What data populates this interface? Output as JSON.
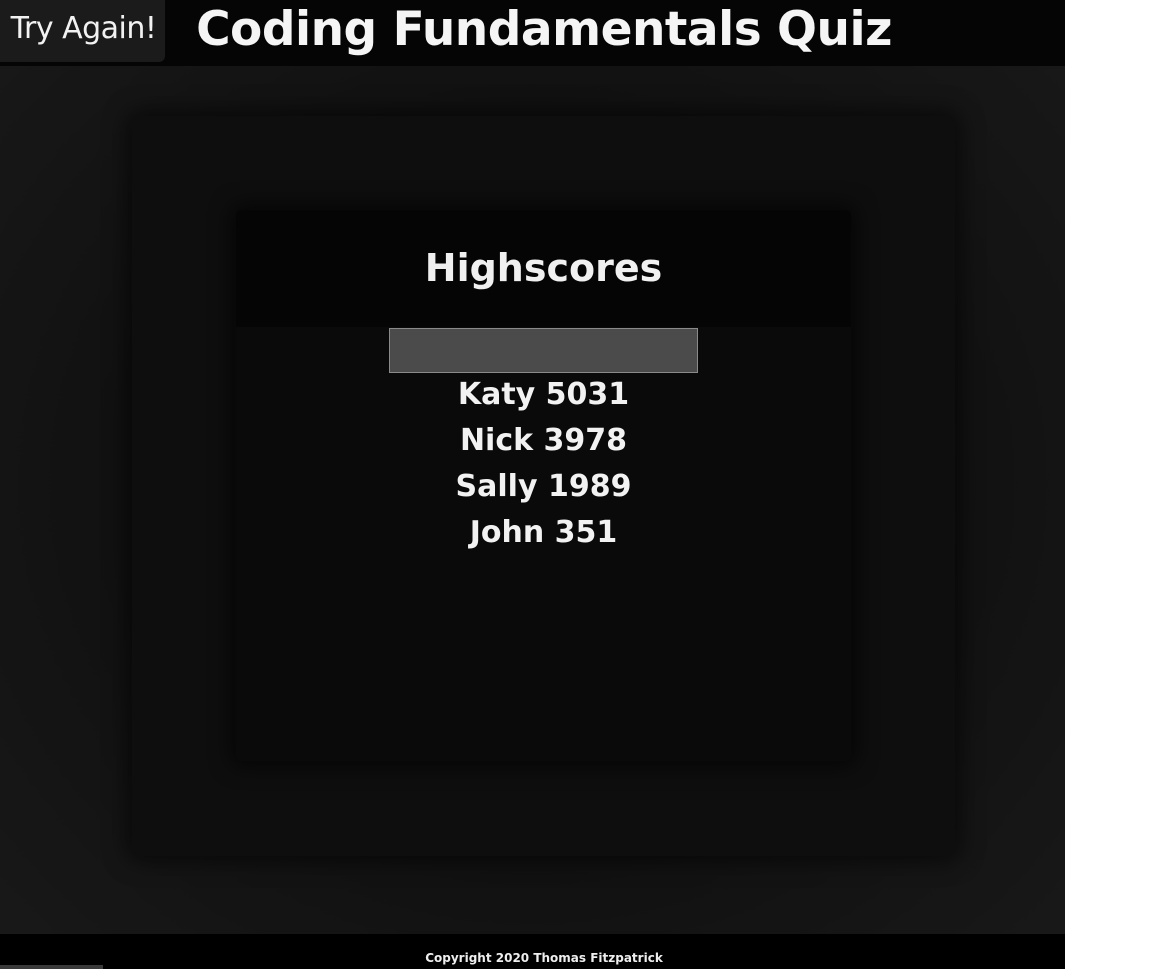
{
  "header": {
    "try_again_label": "Try Again!",
    "title": "Coding Fundamentals Quiz"
  },
  "highscores": {
    "title": "Highscores",
    "input_value": "",
    "entries": [
      {
        "text": "Katy 5031"
      },
      {
        "text": "Nick 3978"
      },
      {
        "text": "Sally 1989"
      },
      {
        "text": "John 351"
      }
    ]
  },
  "footer": {
    "copyright": "Copyright 2020 Thomas Fitzpatrick"
  },
  "colors": {
    "background": "#111111",
    "header": "#050505",
    "input": "#4b4b4b",
    "text": "#f2f2f2"
  }
}
